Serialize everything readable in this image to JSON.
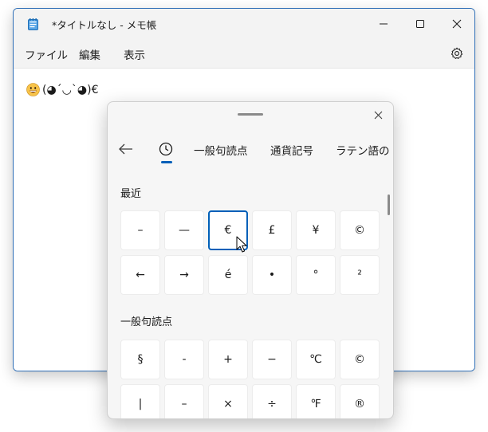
{
  "notepad": {
    "title": "*タイトルなし - メモ帳",
    "menu": [
      "ファイル",
      "編集",
      "表示"
    ],
    "content_text": "(◕´◡`◕)€"
  },
  "panel": {
    "tabs": [
      "一般句読点",
      "通貨記号",
      "ラテン語の"
    ],
    "sections": [
      {
        "title": "最近",
        "symbols": [
          "–",
          "—",
          "€",
          "£",
          "¥",
          "©",
          "←",
          "→",
          "é",
          "•",
          "°",
          "²"
        ]
      },
      {
        "title": "一般句読点",
        "symbols": [
          "§",
          "-",
          "+",
          "−",
          "℃",
          "©",
          "|",
          "–",
          "×",
          "÷",
          "℉",
          "®"
        ]
      }
    ],
    "selected_symbol": "€"
  },
  "icons": {
    "app": "notepad-icon",
    "minimize": "minimize-icon",
    "maximize": "maximize-icon",
    "close": "close-icon",
    "settings": "gear-icon",
    "back": "back-arrow-icon",
    "recent": "clock-icon",
    "emoji": "grinning-face-icon"
  },
  "colors": {
    "accent": "#005fb8",
    "window_border": "#2f6fb7",
    "titlebar_bg": "#f3f3f3",
    "panel_bg": "#f6f6f6"
  }
}
